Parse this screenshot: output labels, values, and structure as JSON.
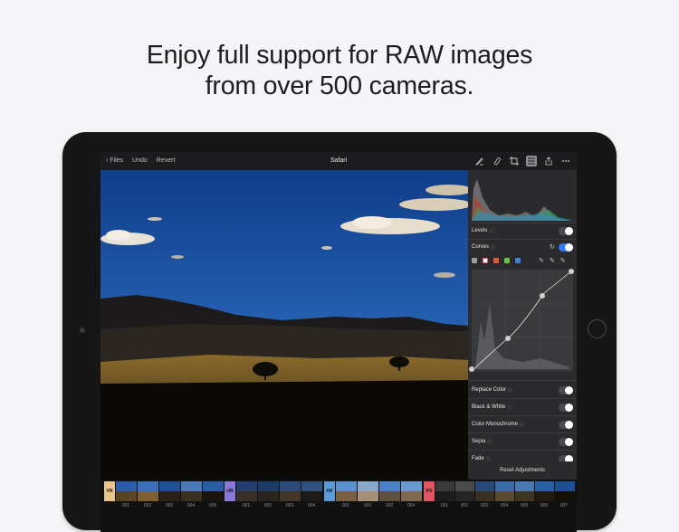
{
  "headline": {
    "line1": "Enjoy full support for RAW images",
    "line2": "from over 500 cameras."
  },
  "topbar": {
    "back_label": "Files",
    "undo_label": "Undo",
    "revert_label": "Revert",
    "title": "Safari",
    "icons": [
      "markup-icon",
      "brush-icon",
      "crop-icon",
      "adjustments-icon",
      "share-icon",
      "more-icon"
    ]
  },
  "panel": {
    "levels": "Levels",
    "curves": "Curves",
    "replace_color": "Replace Color",
    "black_white": "Black & White",
    "color_monochrome": "Color Monochrome",
    "sepia": "Sepia",
    "fade": "Fade",
    "reset": "Reset Adjustments",
    "info_glyph": "ⓘ"
  },
  "filmstrip": {
    "tags": [
      {
        "label": "VN",
        "color": "#e9c48b"
      },
      {
        "label": "UR",
        "color": "#8a7ad8"
      },
      {
        "label": "HX",
        "color": "#5b9bd8"
      },
      {
        "label": "PX",
        "color": "#e05562"
      }
    ],
    "group1": [
      "001",
      "002",
      "003",
      "004",
      "005"
    ],
    "group2": [
      "001",
      "002",
      "003",
      "004"
    ],
    "group3": [
      "001",
      "002",
      "003",
      "004"
    ],
    "group4": [
      "001",
      "002",
      "003",
      "004",
      "005",
      "006",
      "007"
    ]
  },
  "colors": {
    "accent": "#2f7cf6",
    "panel": "#2b2b2d",
    "bar": "#1c1c1e"
  }
}
